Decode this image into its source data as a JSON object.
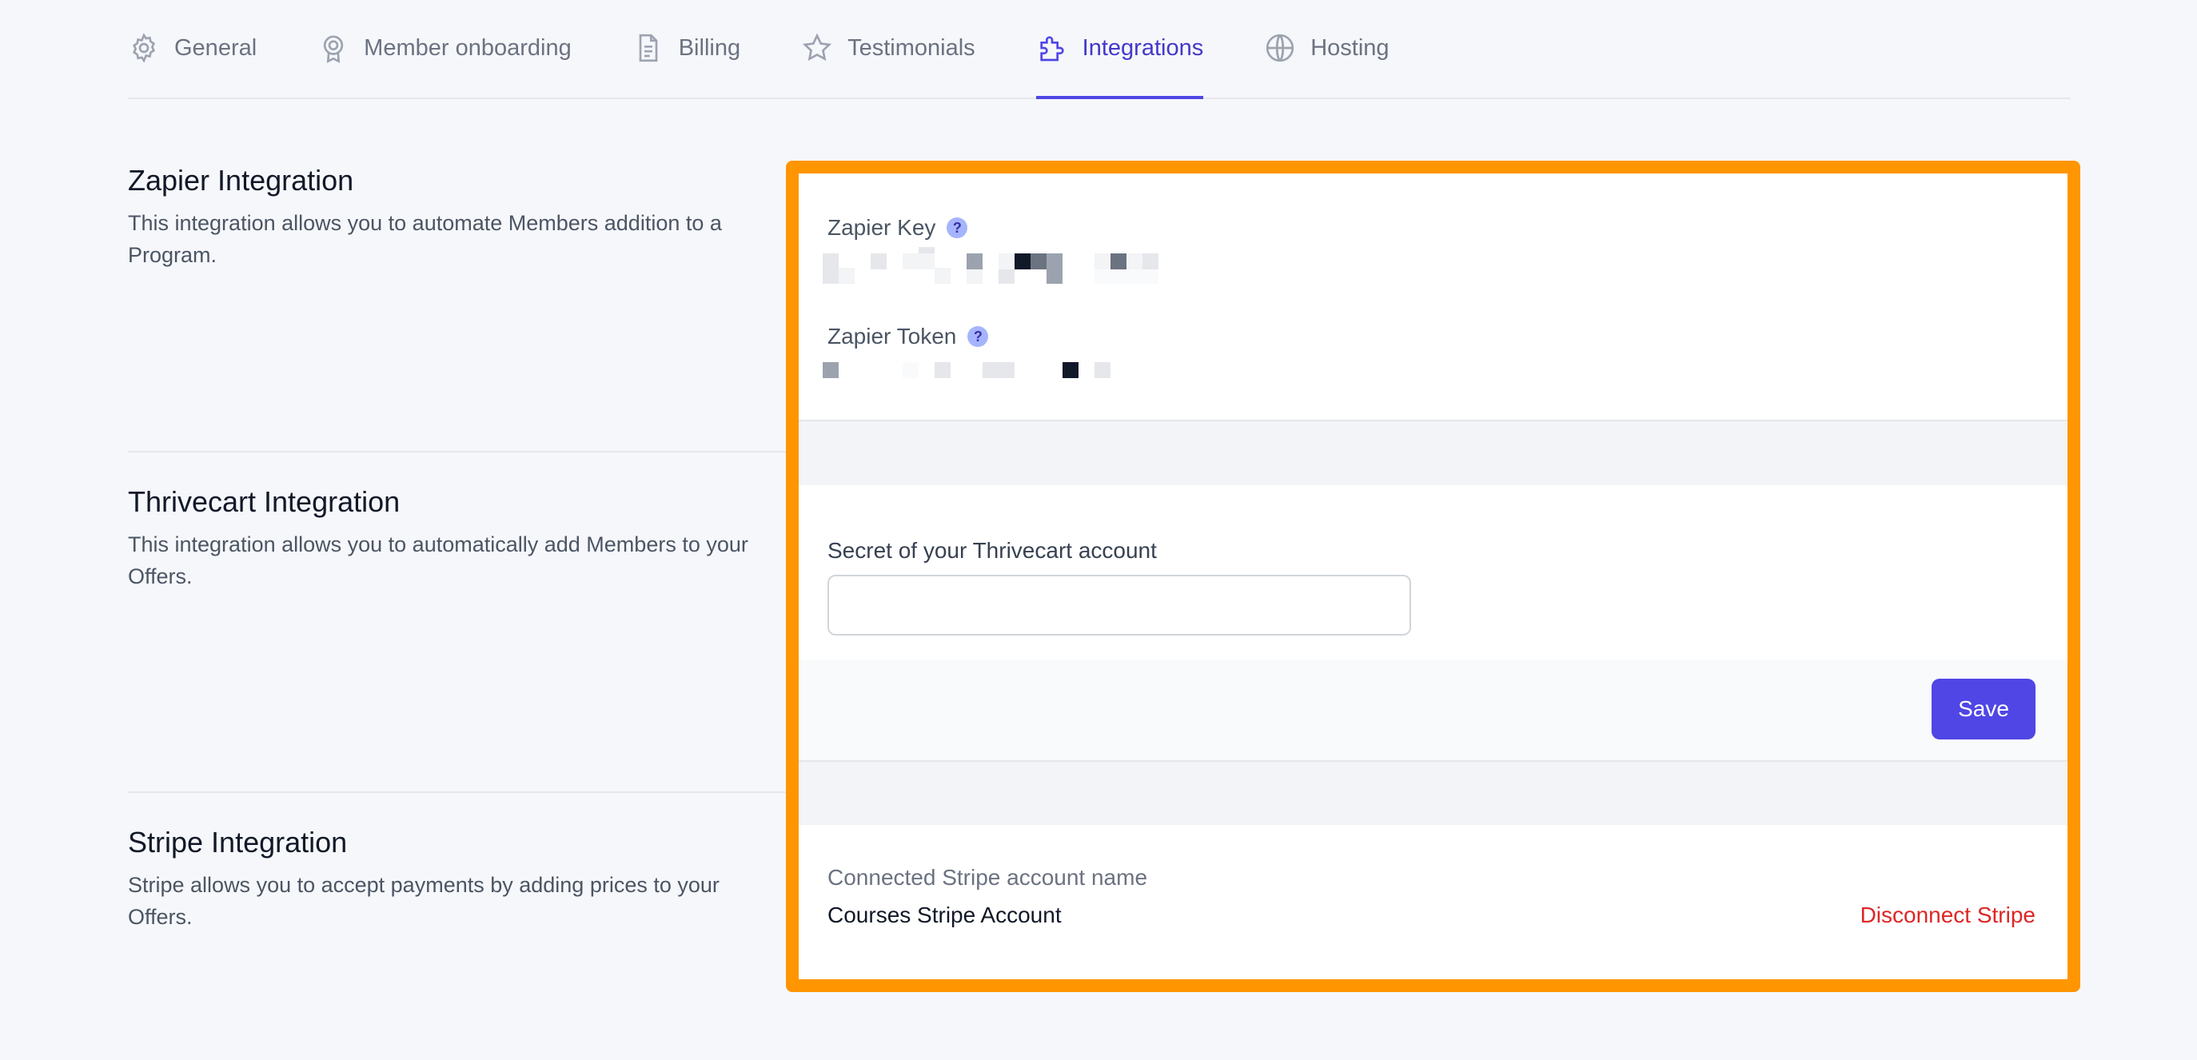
{
  "tabs": [
    {
      "label": "General",
      "icon": "gear-icon",
      "active": false
    },
    {
      "label": "Member onboarding",
      "icon": "badge-icon",
      "active": false
    },
    {
      "label": "Billing",
      "icon": "document-icon",
      "active": false
    },
    {
      "label": "Testimonials",
      "icon": "star-icon",
      "active": false
    },
    {
      "label": "Integrations",
      "icon": "puzzle-icon",
      "active": true
    },
    {
      "label": "Hosting",
      "icon": "globe-icon",
      "active": false
    }
  ],
  "zapier": {
    "title": "Zapier Integration",
    "description": "This integration allows you to automate Members addition to a Program.",
    "key_label": "Zapier Key",
    "token_label": "Zapier Token",
    "help_glyph": "?"
  },
  "thrivecart": {
    "title": "Thrivecart Integration",
    "description": "This integration allows you to automatically add Members to your Offers.",
    "secret_label": "Secret of your Thrivecart account",
    "secret_value": "",
    "save_label": "Save"
  },
  "stripe": {
    "title": "Stripe Integration",
    "description": "Stripe allows you to accept payments by adding prices to your Offers.",
    "account_label": "Connected Stripe account name",
    "account_value": "Courses Stripe Account",
    "disconnect_label": "Disconnect Stripe"
  },
  "colors": {
    "accent": "#4f46e5",
    "highlight": "#ff9500",
    "danger": "#dc2626"
  }
}
